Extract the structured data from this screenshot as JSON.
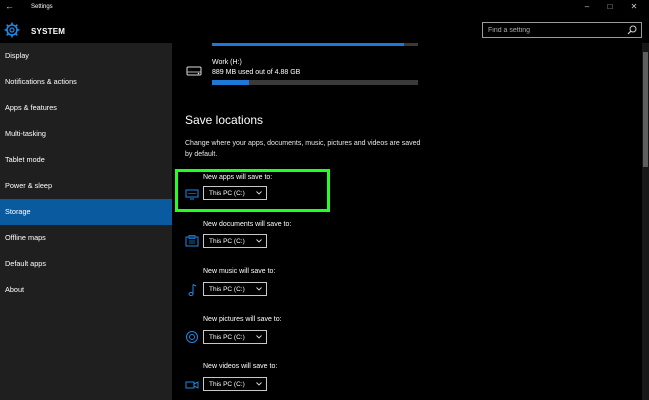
{
  "window": {
    "title": "Settings"
  },
  "header": {
    "section": "SYSTEM",
    "search_placeholder": "Find a setting"
  },
  "sidebar": {
    "items": [
      {
        "label": "Display"
      },
      {
        "label": "Notifications & actions"
      },
      {
        "label": "Apps & features"
      },
      {
        "label": "Multi-tasking"
      },
      {
        "label": "Tablet mode"
      },
      {
        "label": "Power & sleep"
      },
      {
        "label": "Storage"
      },
      {
        "label": "Offline maps"
      },
      {
        "label": "Default apps"
      },
      {
        "label": "About"
      }
    ],
    "active": "Storage"
  },
  "storage": {
    "drive": {
      "name": "Work (H:)",
      "usage": "889 MB used out of 4.88 GB",
      "used_fraction": 0.18
    },
    "previous_drive_used_fraction": 0.93
  },
  "save_locations": {
    "title": "Save locations",
    "description": "Change where your apps, documents, music, pictures and videos are saved by default.",
    "items": [
      {
        "label": "New apps will save to:",
        "value": "This PC (C:)",
        "icon": "monitor-icon"
      },
      {
        "label": "New documents will save to:",
        "value": "This PC (C:)",
        "icon": "documents-folder-icon"
      },
      {
        "label": "New music will save to:",
        "value": "This PC (C:)",
        "icon": "music-note-icon"
      },
      {
        "label": "New pictures will save to:",
        "value": "This PC (C:)",
        "icon": "pictures-icon"
      },
      {
        "label": "New videos will save to:",
        "value": "This PC (C:)",
        "icon": "video-camera-icon"
      }
    ]
  },
  "colors": {
    "accent": "#0a5aa0",
    "bar": "#1e78d7",
    "highlight": "#22ff22"
  }
}
